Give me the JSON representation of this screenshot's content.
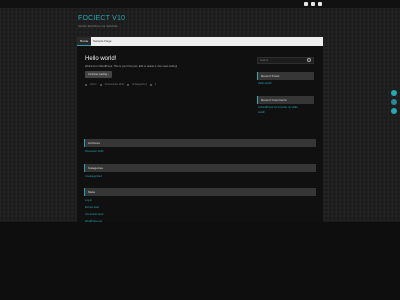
{
  "site": {
    "title": "FOCIECT V10",
    "tagline": "Another WordPress site   Subscribe"
  },
  "nav": {
    "home": "Home",
    "sample": "Sample Page"
  },
  "post": {
    "title": "Hello world!",
    "excerpt": "Welcome to WordPress. This is your first post. Edit or delete it, then start writing!",
    "continue_label": "Continue reading  ›",
    "meta": {
      "author": "Admin",
      "date": "11 November 2020",
      "category": "Uncategorized",
      "comments": "1"
    }
  },
  "sidebar": {
    "search_placeholder": "Search",
    "recent_posts_title": "Recent Posts",
    "recent_posts": [
      "Hello world!"
    ],
    "recent_comments_title": "Recent Comments",
    "recent_comment_line1": "A WordPress Commenter on Hello",
    "recent_comment_line2": "world!"
  },
  "widgets": {
    "archives_title": "Archives",
    "archives_item": "November 2020",
    "categories_title": "Categories",
    "categories_item": "Uncategorized",
    "meta_title": "Meta",
    "meta_items": [
      "Log in",
      "Entries feed",
      "Comments feed",
      "WordPress.org"
    ]
  },
  "colors": {
    "accent": "#27a6b3",
    "panel": "#101010",
    "widget_head": "#363636"
  }
}
